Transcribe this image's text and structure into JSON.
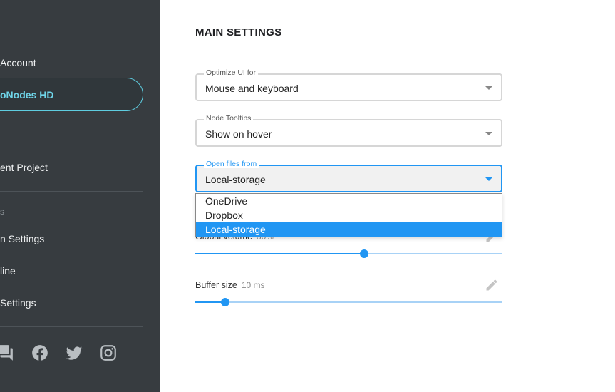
{
  "sidebar": {
    "items": [
      {
        "label": "Account"
      },
      {
        "label": "oNodes HD",
        "active": true
      },
      {
        "label": "ent Project"
      },
      {
        "label": "n Settings"
      },
      {
        "label": "line"
      },
      {
        "label": " Settings"
      }
    ],
    "section_caption": "s",
    "social_icons": [
      "forum-icon",
      "facebook-icon",
      "twitter-icon",
      "instagram-icon"
    ]
  },
  "main": {
    "title": "MAIN SETTINGS",
    "fields": [
      {
        "legend": "Optimize UI for",
        "value": "Mouse and keyboard"
      },
      {
        "legend": "Node Tooltips",
        "value": "Show on hover"
      },
      {
        "legend": "Open files from",
        "value": "Local-storage",
        "focused": true
      }
    ],
    "dropdown": {
      "options": [
        "OneDrive",
        "Dropbox",
        "Local-storage"
      ],
      "selected": "Local-storage"
    },
    "sliders": [
      {
        "label": "Global volume",
        "value_text": "80%",
        "fraction": 0.55
      },
      {
        "label": "Buffer size",
        "value_text": "10 ms",
        "fraction": 0.098
      }
    ]
  },
  "colors": {
    "sidebar_bg": "#373c40",
    "accent": "#2196f3",
    "active_item": "#6fd6ea"
  }
}
